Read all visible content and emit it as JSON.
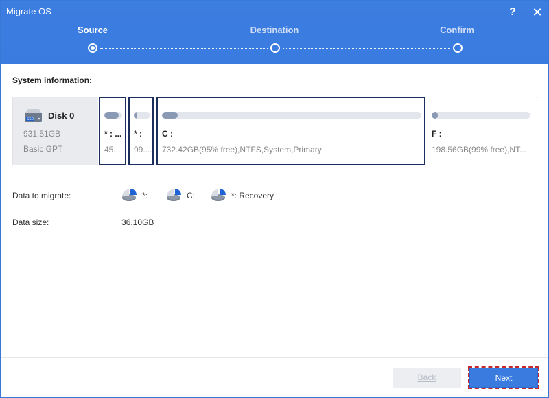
{
  "window": {
    "title": "Migrate OS"
  },
  "titlebar": {
    "help_label": "?",
    "close_label": "✕"
  },
  "steps": [
    {
      "label": "Source",
      "active": true
    },
    {
      "label": "Destination",
      "active": false
    },
    {
      "label": "Confirm",
      "active": false
    }
  ],
  "system_info": {
    "title": "System information:",
    "disk": {
      "name": "Disk 0",
      "size": "931.51GB",
      "type": "Basic GPT",
      "icon": "ssd-disk-icon",
      "badge": "SSD"
    },
    "partitions": [
      {
        "label": "* : ...",
        "desc": "45...",
        "used_fraction": 0.8,
        "selected": true
      },
      {
        "label": "* :",
        "desc": "99....",
        "used_fraction": 0.2,
        "selected": true
      },
      {
        "label": "C :",
        "desc": "732.42GB(95% free),NTFS,System,Primary",
        "used_fraction": 0.05,
        "selected": true
      },
      {
        "label": "F :",
        "desc": "198.56GB(99% free),NT...",
        "used_fraction": 0.01,
        "selected": false
      }
    ]
  },
  "migrate": {
    "label": "Data to migrate:",
    "items": [
      {
        "text": "*:",
        "icon": "pie-chart-icon"
      },
      {
        "text": "C:",
        "icon": "pie-chart-icon"
      },
      {
        "text": "*: Recovery",
        "icon": "pie-chart-icon"
      }
    ]
  },
  "size": {
    "label": "Data size:",
    "value": "36.10GB"
  },
  "buttons": {
    "back": "Back",
    "next": "Next"
  },
  "colors": {
    "accent": "#3a7be0",
    "selected_border": "#1c2e5e",
    "focus_outline": "#c62828"
  }
}
